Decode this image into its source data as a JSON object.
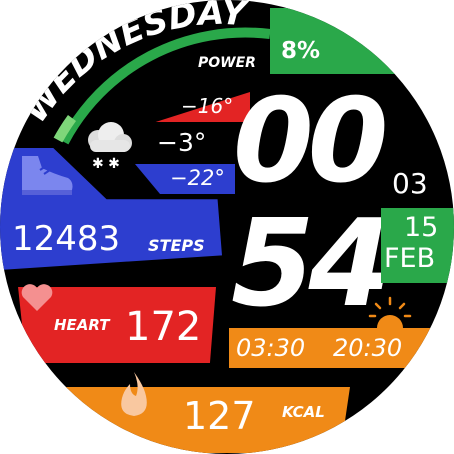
{
  "watchface": {
    "day_of_week": "WEDNESDAY",
    "power": {
      "label": "POWER",
      "value": "8%"
    },
    "weather": {
      "high": "−16°",
      "current": "−3°",
      "low": "−22°",
      "icon": "snow-cloud-icon"
    },
    "steps": {
      "value": "12483",
      "label": "STEPS",
      "icon": "shoe-icon"
    },
    "heart": {
      "label": "HEART",
      "value": "172",
      "icon": "heart-icon"
    },
    "calories": {
      "value": "127",
      "label": "KCAL",
      "icon": "flame-icon"
    },
    "time": {
      "hour": "00",
      "minute": "54",
      "seconds": "03"
    },
    "date": {
      "day": "15",
      "month": "FEB"
    },
    "sun": {
      "sunrise": "03:30",
      "sunset": "20:30",
      "icon": "sunset-icon"
    }
  },
  "colors": {
    "background": "#000000",
    "green": "#2aa84a",
    "red": "#e32424",
    "blue": "#2d3ecf",
    "orange": "#f08a17"
  }
}
